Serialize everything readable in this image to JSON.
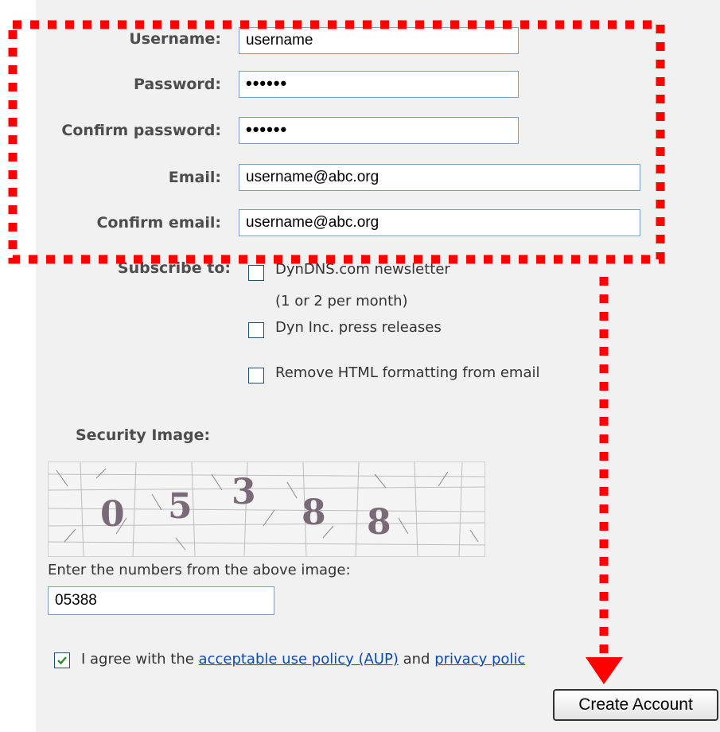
{
  "form": {
    "username": {
      "label": "Username:",
      "value": "username"
    },
    "password": {
      "label": "Password:",
      "value": "••••••"
    },
    "confirm_password": {
      "label": "Confirm password:",
      "value": "••••••"
    },
    "email": {
      "label": "Email:",
      "value": "username@abc.org"
    },
    "confirm_email": {
      "label": "Confirm email:",
      "value": "username@abc.org"
    }
  },
  "subscribe": {
    "label": "Subscribe to:",
    "options": [
      {
        "text": "DynDNS.com newsletter",
        "sub": "(1 or 2 per month)",
        "checked": false
      },
      {
        "text": "Dyn Inc. press releases",
        "checked": false
      },
      {
        "text": "Remove HTML formatting from email",
        "checked": false
      }
    ]
  },
  "security": {
    "title": "Security Image:",
    "captcha_digits": [
      "0",
      "5",
      "3",
      "8",
      "8"
    ],
    "prompt": "Enter the numbers from the above image:",
    "value": "05388"
  },
  "agree": {
    "checked": true,
    "prefix": "I agree with the ",
    "aup_link": "acceptable use policy (AUP)",
    "middle": " and ",
    "privacy_link": "privacy polic"
  },
  "create_button": "Create Account",
  "colors": {
    "annotation_red": "#ff0000",
    "panel_bg": "#f1f1f1",
    "link": "#0b4ab1",
    "check": "#2e8b2e"
  }
}
